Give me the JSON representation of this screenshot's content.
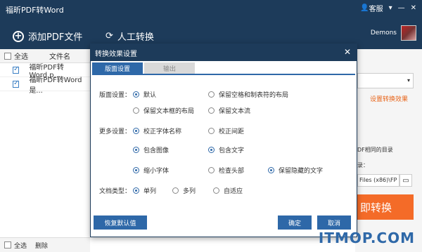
{
  "app": {
    "title": "福昕PDF转Word"
  },
  "titlebar": {
    "service_label": "客服",
    "user_name": "Demons"
  },
  "toolbar": {
    "add_pdf": "添加PDF文件",
    "manual": "人工转换"
  },
  "file_list": {
    "header": {
      "select_all": "全选",
      "col_filename": "文件名"
    },
    "rows": [
      {
        "name": "福昕PDF转Word.p...",
        "checked": true
      },
      {
        "name": "福昕PDF转Word是...",
        "checked": true
      }
    ]
  },
  "bottom": {
    "select_all": "全选",
    "delete": "删除"
  },
  "right": {
    "settings_link": "设置转换效果",
    "same_dir_text": "DF相同的目录",
    "dir_label": "录：",
    "path": "Files (x86)\\FP",
    "convert_btn": "即转换"
  },
  "dialog": {
    "title": "转换效果设置",
    "tabs": [
      "版面设置",
      "输出"
    ],
    "layout": {
      "label": "版面设置：",
      "opt1": "默认",
      "opt2": "保留空格和制表符的布局",
      "opt3": "保留文本框的布局",
      "opt4": "保留文本流"
    },
    "more": {
      "label": "更多设置：",
      "opt1": "校正字体名称",
      "opt2": "校正间距",
      "opt3": "包含图像",
      "opt4": "包含文字",
      "opt5": "缩小字体",
      "opt6": "检查头部",
      "opt7": "保留隐藏的文字"
    },
    "doc_type": {
      "label": "文档类型：",
      "opt1": "单列",
      "opt2": "多列",
      "opt3": "自适应"
    },
    "buttons": {
      "restore": "恢复默认值",
      "ok": "确定",
      "cancel": "取消"
    }
  },
  "watermark": "ITMOP.COM"
}
